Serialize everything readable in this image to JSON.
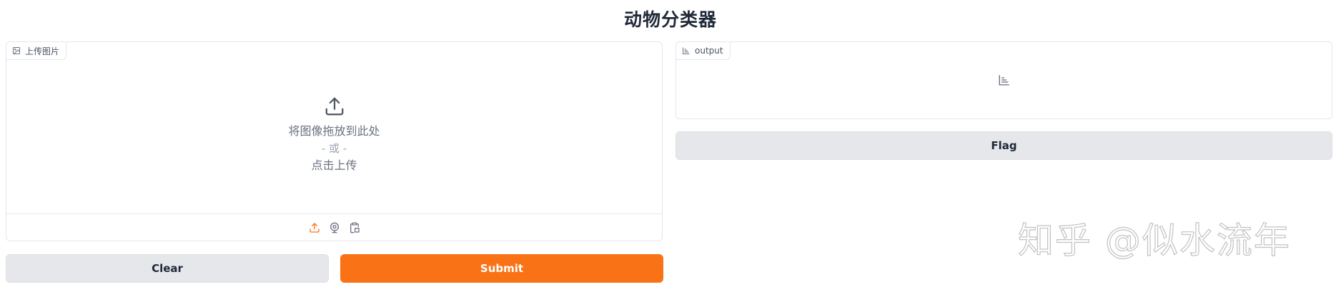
{
  "app": {
    "title": "动物分类器"
  },
  "input_panel": {
    "label": "上传图片",
    "drop_text": "将图像拖放到此处",
    "or_text": "- 或 -",
    "click_text": "点击上传"
  },
  "output_panel": {
    "label": "output"
  },
  "buttons": {
    "clear": "Clear",
    "submit": "Submit",
    "flag": "Flag"
  },
  "watermark": {
    "text": "知乎 @似水流年"
  },
  "colors": {
    "primary": "#f97316",
    "secondary": "#e5e7eb",
    "accent_icon": "#f97316"
  },
  "icons": {
    "input_label": "image-icon",
    "upload": "upload-icon",
    "webcam": "webcam-icon",
    "clipboard": "clipboard-icon",
    "output_label": "bar-chart-icon"
  }
}
